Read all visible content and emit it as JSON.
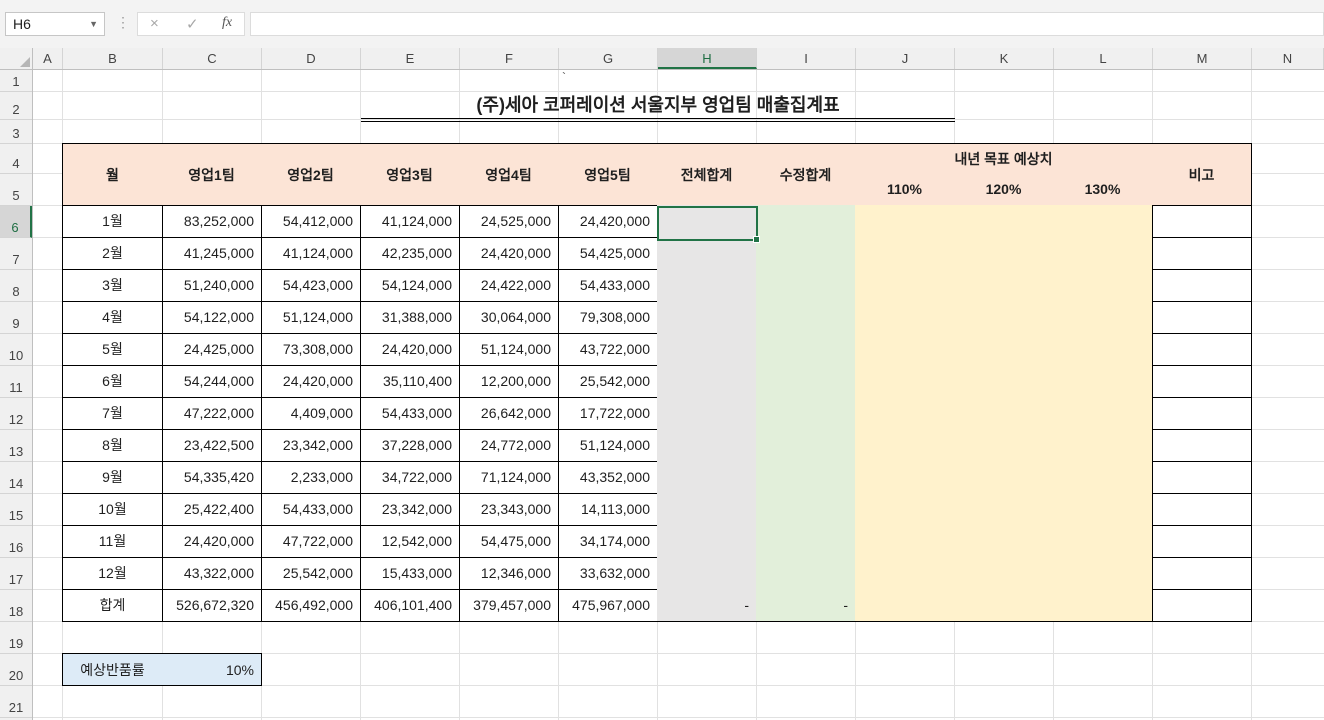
{
  "formula_bar": {
    "name_box": "H6",
    "fx_label": "fx",
    "cancel_icon": "×",
    "enter_icon": "✓",
    "formula_value": ""
  },
  "columns": [
    "A",
    "B",
    "C",
    "D",
    "E",
    "F",
    "G",
    "H",
    "I",
    "J",
    "K",
    "L",
    "M",
    "N"
  ],
  "selected_column": "H",
  "rows": [
    "1",
    "2",
    "3",
    "4",
    "5",
    "6",
    "7",
    "8",
    "9",
    "10",
    "11",
    "12",
    "13",
    "14",
    "15",
    "16",
    "17",
    "18",
    "19",
    "20",
    "21"
  ],
  "selected_row": "6",
  "sheet": {
    "tick_mark": "`",
    "title": "(주)세아 코퍼레이션 서울지부 영업팀 매출집계표",
    "headers": {
      "month": "월",
      "team1": "영업1팀",
      "team2": "영업2팀",
      "team3": "영업3팀",
      "team4": "영업4팀",
      "team5": "영업5팀",
      "total": "전체합계",
      "adjusted": "수정합계",
      "target_group": "내년 목표 예상치",
      "t110": "110%",
      "t120": "120%",
      "t130": "130%",
      "note": "비고"
    },
    "data_rows": [
      {
        "month": "1월",
        "t1": "83,252,000",
        "t2": "54,412,000",
        "t3": "41,124,000",
        "t4": "24,525,000",
        "t5": "24,420,000"
      },
      {
        "month": "2월",
        "t1": "41,245,000",
        "t2": "41,124,000",
        "t3": "42,235,000",
        "t4": "24,420,000",
        "t5": "54,425,000"
      },
      {
        "month": "3월",
        "t1": "51,240,000",
        "t2": "54,423,000",
        "t3": "54,124,000",
        "t4": "24,422,000",
        "t5": "54,433,000"
      },
      {
        "month": "4월",
        "t1": "54,122,000",
        "t2": "51,124,000",
        "t3": "31,388,000",
        "t4": "30,064,000",
        "t5": "79,308,000"
      },
      {
        "month": "5월",
        "t1": "24,425,000",
        "t2": "73,308,000",
        "t3": "24,420,000",
        "t4": "51,124,000",
        "t5": "43,722,000"
      },
      {
        "month": "6월",
        "t1": "54,244,000",
        "t2": "24,420,000",
        "t3": "35,110,400",
        "t4": "12,200,000",
        "t5": "25,542,000"
      },
      {
        "month": "7월",
        "t1": "47,222,000",
        "t2": "4,409,000",
        "t3": "54,433,000",
        "t4": "26,642,000",
        "t5": "17,722,000"
      },
      {
        "month": "8월",
        "t1": "23,422,500",
        "t2": "23,342,000",
        "t3": "37,228,000",
        "t4": "24,772,000",
        "t5": "51,124,000"
      },
      {
        "month": "9월",
        "t1": "54,335,420",
        "t2": "2,233,000",
        "t3": "34,722,000",
        "t4": "71,124,000",
        "t5": "43,352,000"
      },
      {
        "month": "10월",
        "t1": "25,422,400",
        "t2": "54,433,000",
        "t3": "23,342,000",
        "t4": "23,343,000",
        "t5": "14,113,000"
      },
      {
        "month": "11월",
        "t1": "24,420,000",
        "t2": "47,722,000",
        "t3": "12,542,000",
        "t4": "54,475,000",
        "t5": "34,174,000"
      },
      {
        "month": "12월",
        "t1": "43,322,000",
        "t2": "25,542,000",
        "t3": "15,433,000",
        "t4": "12,346,000",
        "t5": "33,632,000"
      }
    ],
    "total_row": {
      "label": "합계",
      "t1": "526,672,320",
      "t2": "456,492,000",
      "t3": "406,101,400",
      "t4": "379,457,000",
      "t5": "475,967,000",
      "total": "-",
      "adjusted": "-"
    },
    "return_rate": {
      "label": "예상반품률",
      "value": "10%"
    }
  },
  "colors": {
    "header_fill": "#fce4d6",
    "total_fill": "#e7e6e6",
    "adjusted_fill": "#e2efda",
    "target_fill": "#fff2cc",
    "return_fill": "#ddebf7",
    "accent": "#217346"
  }
}
